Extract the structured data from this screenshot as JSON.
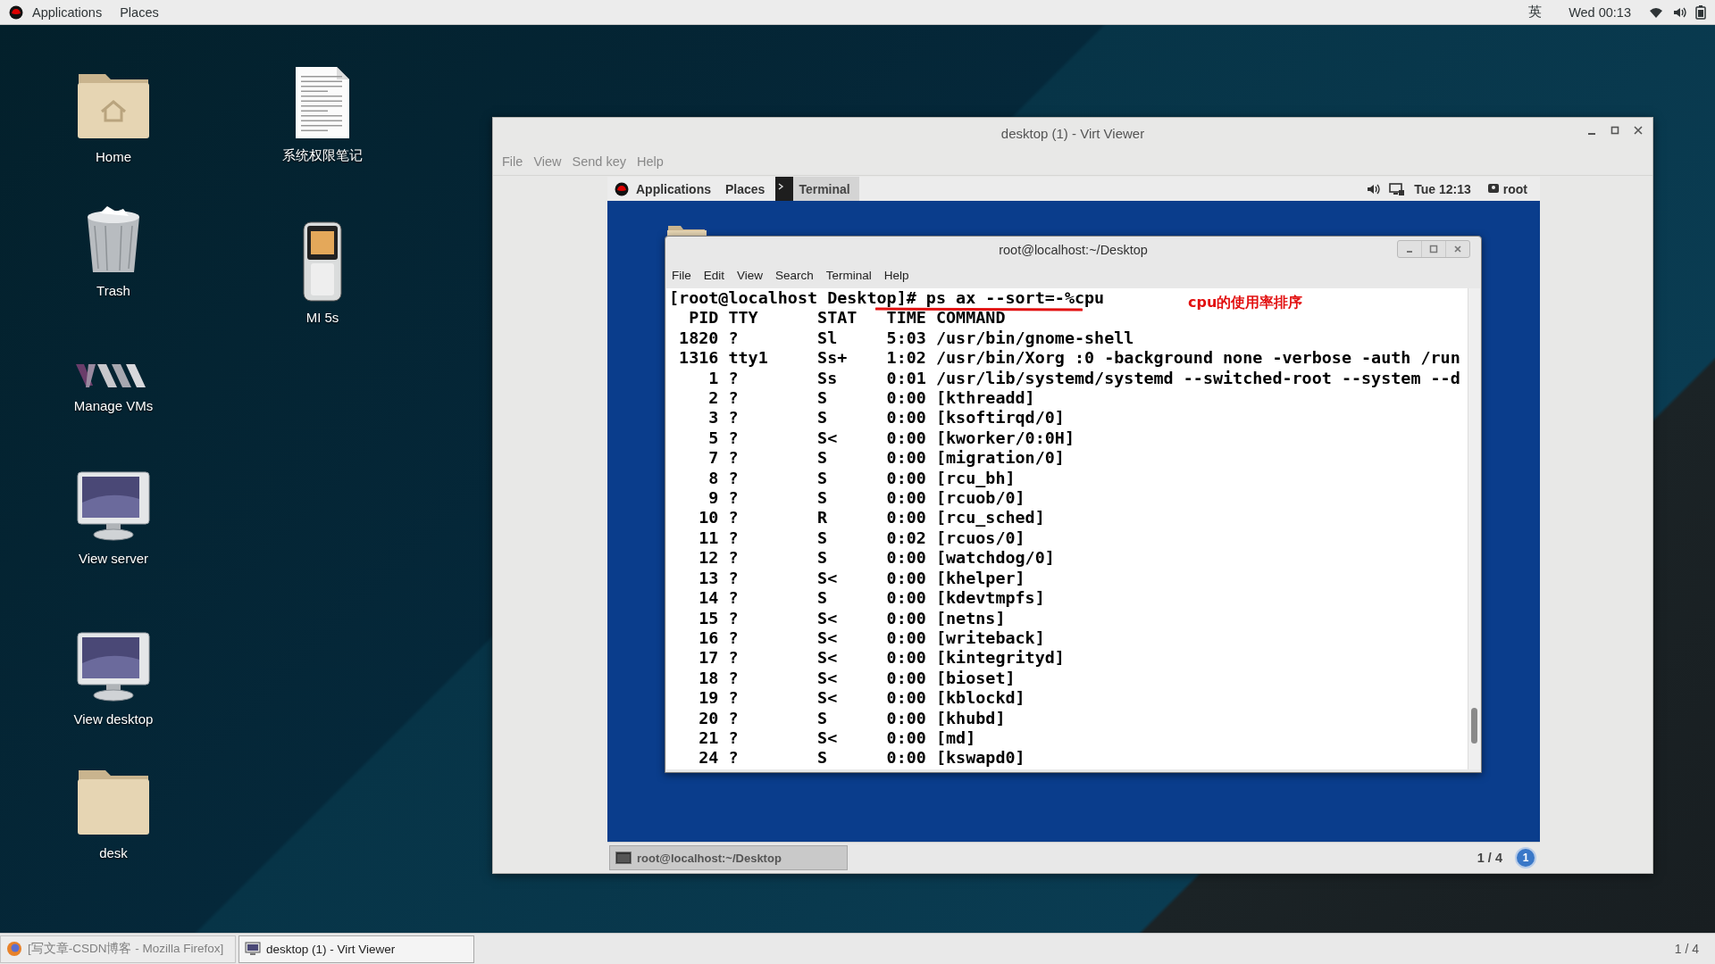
{
  "top_bar": {
    "menus": [
      "Applications",
      "Places"
    ],
    "input_method": "英",
    "clock": "Wed 00:13"
  },
  "desktop_icons": {
    "column_1": [
      {
        "label": "Home",
        "kind": "home-folder"
      },
      {
        "label": "Trash",
        "kind": "trash"
      },
      {
        "label": "Manage VMs",
        "kind": "vm-manager"
      },
      {
        "label": "View server",
        "kind": "monitor"
      },
      {
        "label": "View desktop",
        "kind": "monitor"
      },
      {
        "label": "desk",
        "kind": "folder"
      }
    ],
    "column_2": [
      {
        "label": "系统权限笔记",
        "kind": "document"
      },
      {
        "label": "MI 5s",
        "kind": "phone"
      }
    ]
  },
  "window": {
    "title": "desktop (1) - Virt Viewer",
    "menus": [
      "File",
      "View",
      "Send key",
      "Help"
    ],
    "guest": {
      "top_bar": {
        "menus": [
          "Applications",
          "Places"
        ],
        "app": "Terminal",
        "clock": "Tue 12:13",
        "user": "root"
      },
      "terminal": {
        "title": "root@localhost:~/Desktop",
        "menus": [
          "File",
          "Edit",
          "View",
          "Search",
          "Terminal",
          "Help"
        ],
        "prompt": "[root@localhost Desktop]# ",
        "command": "ps ax --sort=-%cpu",
        "annotation": "cpu的使用率排序",
        "columns": [
          "PID",
          "TTY",
          "STAT",
          "TIME",
          "COMMAND"
        ],
        "rows": [
          {
            "pid": "1820",
            "tty": "?",
            "stat": "Sl",
            "time": "5:03",
            "command": "/usr/bin/gnome-shell"
          },
          {
            "pid": "1316",
            "tty": "tty1",
            "stat": "Ss+",
            "time": "1:02",
            "command": "/usr/bin/Xorg :0 -background none -verbose -auth /run"
          },
          {
            "pid": "1",
            "tty": "?",
            "stat": "Ss",
            "time": "0:01",
            "command": "/usr/lib/systemd/systemd --switched-root --system --d"
          },
          {
            "pid": "2",
            "tty": "?",
            "stat": "S",
            "time": "0:00",
            "command": "[kthreadd]"
          },
          {
            "pid": "3",
            "tty": "?",
            "stat": "S",
            "time": "0:00",
            "command": "[ksoftirqd/0]"
          },
          {
            "pid": "5",
            "tty": "?",
            "stat": "S<",
            "time": "0:00",
            "command": "[kworker/0:0H]"
          },
          {
            "pid": "7",
            "tty": "?",
            "stat": "S",
            "time": "0:00",
            "command": "[migration/0]"
          },
          {
            "pid": "8",
            "tty": "?",
            "stat": "S",
            "time": "0:00",
            "command": "[rcu_bh]"
          },
          {
            "pid": "9",
            "tty": "?",
            "stat": "S",
            "time": "0:00",
            "command": "[rcuob/0]"
          },
          {
            "pid": "10",
            "tty": "?",
            "stat": "R",
            "time": "0:00",
            "command": "[rcu_sched]"
          },
          {
            "pid": "11",
            "tty": "?",
            "stat": "S",
            "time": "0:02",
            "command": "[rcuos/0]"
          },
          {
            "pid": "12",
            "tty": "?",
            "stat": "S",
            "time": "0:00",
            "command": "[watchdog/0]"
          },
          {
            "pid": "13",
            "tty": "?",
            "stat": "S<",
            "time": "0:00",
            "command": "[khelper]"
          },
          {
            "pid": "14",
            "tty": "?",
            "stat": "S",
            "time": "0:00",
            "command": "[kdevtmpfs]"
          },
          {
            "pid": "15",
            "tty": "?",
            "stat": "S<",
            "time": "0:00",
            "command": "[netns]"
          },
          {
            "pid": "16",
            "tty": "?",
            "stat": "S<",
            "time": "0:00",
            "command": "[writeback]"
          },
          {
            "pid": "17",
            "tty": "?",
            "stat": "S<",
            "time": "0:00",
            "command": "[kintegrityd]"
          },
          {
            "pid": "18",
            "tty": "?",
            "stat": "S<",
            "time": "0:00",
            "command": "[bioset]"
          },
          {
            "pid": "19",
            "tty": "?",
            "stat": "S<",
            "time": "0:00",
            "command": "[kblockd]"
          },
          {
            "pid": "20",
            "tty": "?",
            "stat": "S",
            "time": "0:00",
            "command": "[khubd]"
          },
          {
            "pid": "21",
            "tty": "?",
            "stat": "S<",
            "time": "0:00",
            "command": "[md]"
          },
          {
            "pid": "24",
            "tty": "?",
            "stat": "S",
            "time": "0:00",
            "command": "[kswapd0]"
          }
        ]
      },
      "bottom_bar": {
        "task": "root@localhost:~/Desktop",
        "workspace": "1 / 4",
        "notifications": "1"
      }
    }
  },
  "taskbar": {
    "items": [
      {
        "label": "[写文章-CSDN博客 - Mozilla Firefox]",
        "kind": "firefox",
        "selected": false
      },
      {
        "label": "desktop (1) - Virt Viewer",
        "kind": "virt-viewer",
        "selected": true
      }
    ],
    "workspace": "1 / 4"
  }
}
